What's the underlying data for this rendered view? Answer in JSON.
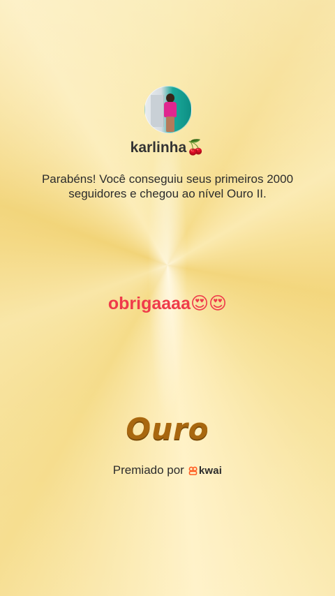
{
  "profile": {
    "username": "karlinha🍒"
  },
  "congrats_message": "Parabéns! Você conseguiu seus primeiros 2000 seguidores e chegou ao nível Ouro II.",
  "user_message": "obrigaaaa😍😍",
  "level": {
    "name": "Ouro"
  },
  "footer": {
    "awarded_by_label": "Premiado por",
    "brand_name": "kwai",
    "brand_color": "#ff5a1f"
  },
  "colors": {
    "background_gold": "#f6dc8a",
    "message_red": "#ef3a4a",
    "level_gold": "#a8670f"
  }
}
